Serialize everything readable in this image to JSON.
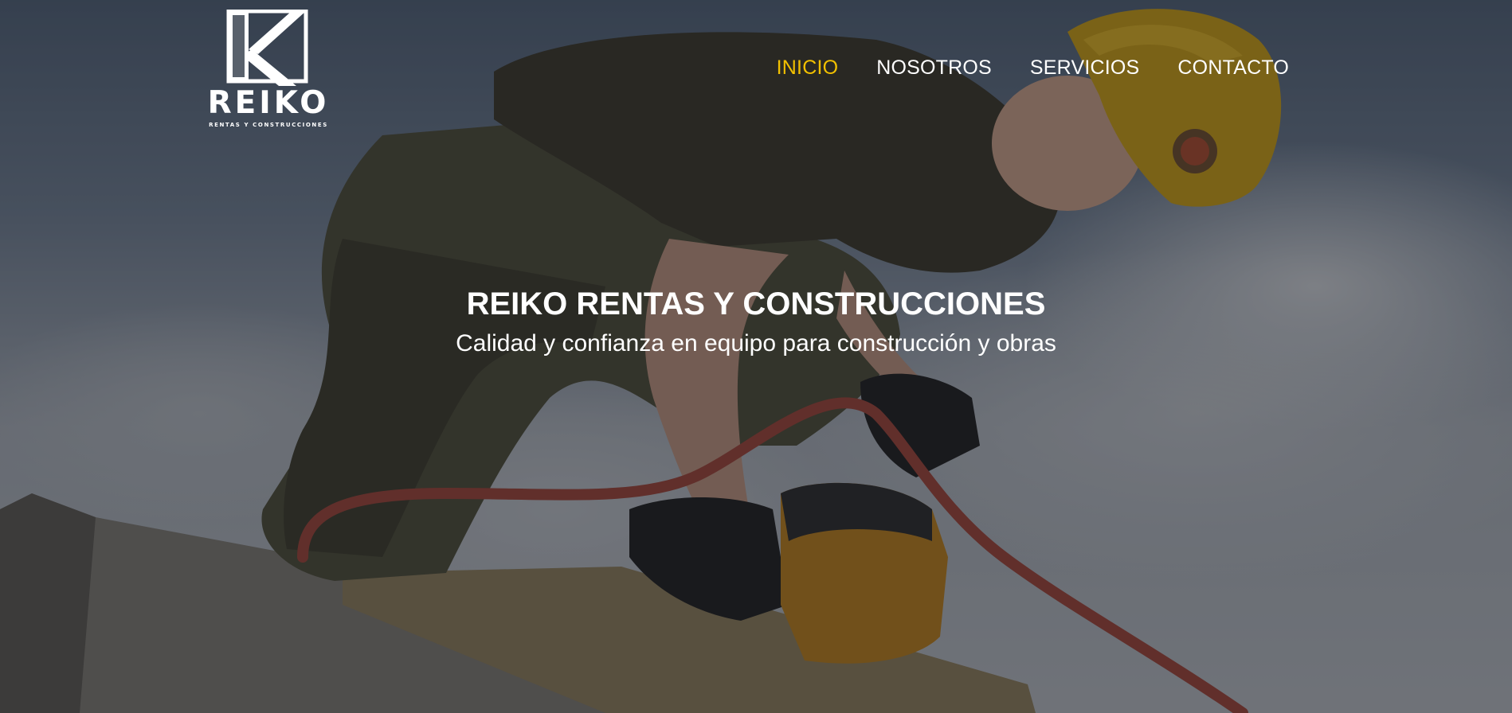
{
  "brand": {
    "name": "REIKO",
    "tagline": "RENTAS Y CONSTRUCCIONES"
  },
  "nav": {
    "items": [
      {
        "label": "INICIO",
        "active": true
      },
      {
        "label": "NOSOTROS",
        "active": false
      },
      {
        "label": "SERVICIOS",
        "active": false
      },
      {
        "label": "CONTACTO",
        "active": false
      }
    ]
  },
  "hero": {
    "title": "REIKO RENTAS Y CONSTRUCCIONES",
    "subtitle": "Calidad y confianza en equipo para construcción y obras",
    "background": "construction-worker-roof-photo"
  },
  "colors": {
    "accent": "#f1c000",
    "text": "#ffffff"
  }
}
